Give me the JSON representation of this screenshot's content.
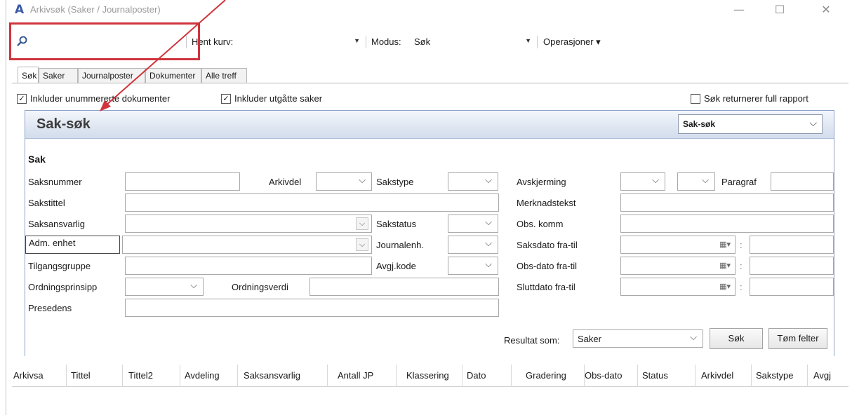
{
  "window": {
    "title": "Arkivsøk (Saker / Journalposter)",
    "app_icon": "A",
    "minimize": "—",
    "maximize": "☐",
    "close": "✕"
  },
  "toolbar": {
    "search_value": "",
    "hent_kurv_label": "Hent kurv:",
    "hent_kurv_value": "",
    "modus_label": "Modus:",
    "modus_value": "Søk",
    "operasjoner_label": "Operasjoner ▾"
  },
  "tabs": [
    "Søk",
    "Saker",
    "Journalposter",
    "Dokumenter",
    "Alle treff"
  ],
  "options": {
    "inkluder_unummererte": {
      "label": "Inkluder unummererte dokumenter",
      "checked": true
    },
    "inkluder_utgatte": {
      "label": "Inkluder utgåtte saker",
      "checked": true
    },
    "full_rapport": {
      "label": "Søk returnerer full rapport",
      "checked": false
    }
  },
  "panel": {
    "title": "Sak-søk",
    "type_value": "Sak-søk",
    "section": "Sak",
    "labels": {
      "saksnummer": "Saksnummer",
      "arkivdel": "Arkivdel",
      "sakstype": "Sakstype",
      "avskjerming": "Avskjerming",
      "paragraf": "Paragraf",
      "sakstittel": "Sakstittel",
      "merknadstekst": "Merknadstekst",
      "saksansvarlig": "Saksansvarlig",
      "sakstatus": "Sakstatus",
      "obs_komm": "Obs. komm",
      "adm_enhet": "Adm. enhet",
      "journalenh": "Journalenh.",
      "saksdato": "Saksdato fra-til",
      "tilgangsgruppe": "Tilgangsgruppe",
      "avgj_kode": "Avgj.kode",
      "obs_dato": "Obs-dato fra-til",
      "ordningsprinsipp": "Ordningsprinsipp",
      "ordningsverdi": "Ordningsverdi",
      "sluttdato": "Sluttdato fra-til",
      "presedens": "Presedens"
    },
    "resultat_label": "Resultat som:",
    "resultat_value": "Saker",
    "sok_button": "Søk",
    "tom_button": "Tøm felter",
    "date_sep": ":"
  },
  "grid": {
    "columns": [
      "Arkivsa",
      "Tittel",
      "Tittel2",
      "Avdeling",
      "Saksansvarlig",
      "Antall JP",
      "Klassering",
      "Dato",
      "Gradering",
      "Obs-dato",
      "Status",
      "Arkivdel",
      "Sakstype",
      "Avgj"
    ]
  },
  "colors": {
    "highlight": "#d0333c",
    "panel_header": "#d2dcec",
    "accent": "#3a5aa8"
  }
}
